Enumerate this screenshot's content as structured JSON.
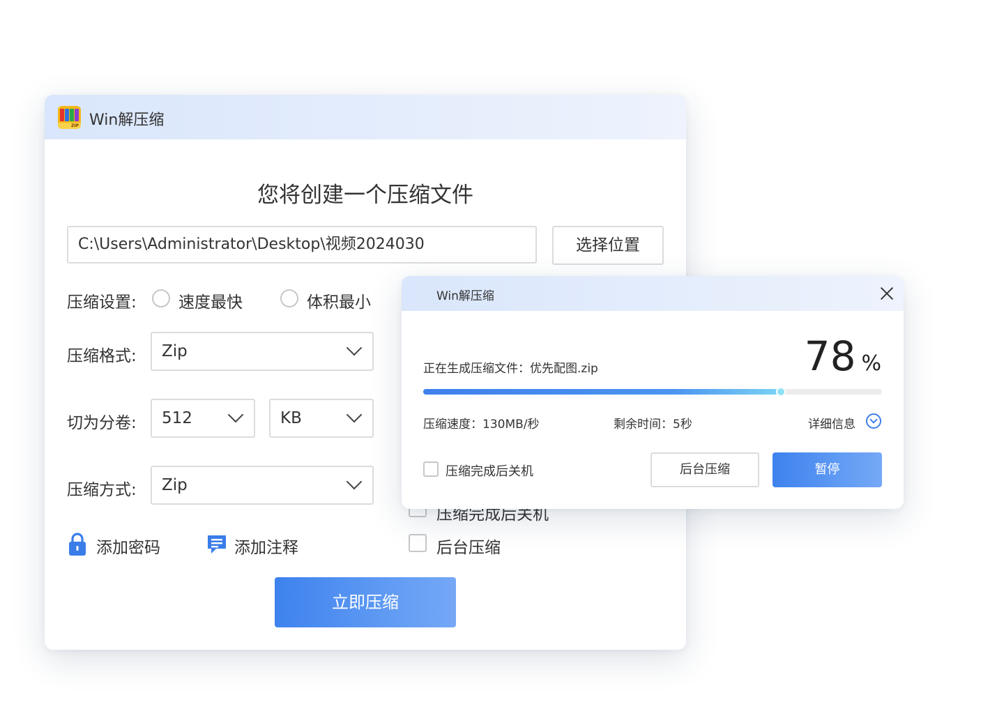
{
  "main_window": {
    "title": "Win解压缩",
    "heading": "您将创建一个压缩文件",
    "path_value": "C:\\Users\\Administrator\\Desktop\\视频2024030",
    "choose_location": "选择位置",
    "compress_settings": {
      "label": "压缩设置:",
      "options": [
        "速度最快",
        "体积最小"
      ]
    },
    "format": {
      "label": "压缩格式:",
      "value": "Zip"
    },
    "split": {
      "label": "切为分卷:",
      "size": "512",
      "unit": "KB"
    },
    "method": {
      "label": "压缩方式:",
      "value": "Zip"
    },
    "add_password": "添加密码",
    "add_comment": "添加注释",
    "shutdown_after_partial": "压缩完成后关机",
    "background_compress": "后台压缩",
    "compress_now": "立即压缩",
    "logo_text": "ZIP"
  },
  "progress_dialog": {
    "title": "Win解压缩",
    "status_label": "正在生成压缩文件：优先配图.zip",
    "percent_value": "78",
    "percent_sign": "%",
    "progress_fraction": 0.78,
    "speed": "压缩速度：130MB/秒",
    "remaining": "剩余时间：5秒",
    "details": "详细信息",
    "shutdown_after": "压缩完成后关机",
    "background_button": "后台压缩",
    "pause_button": "暂停"
  },
  "colors": {
    "accent": "#3e82ee",
    "titlebar": "#d9e6fb",
    "logo": "#f5b716"
  }
}
